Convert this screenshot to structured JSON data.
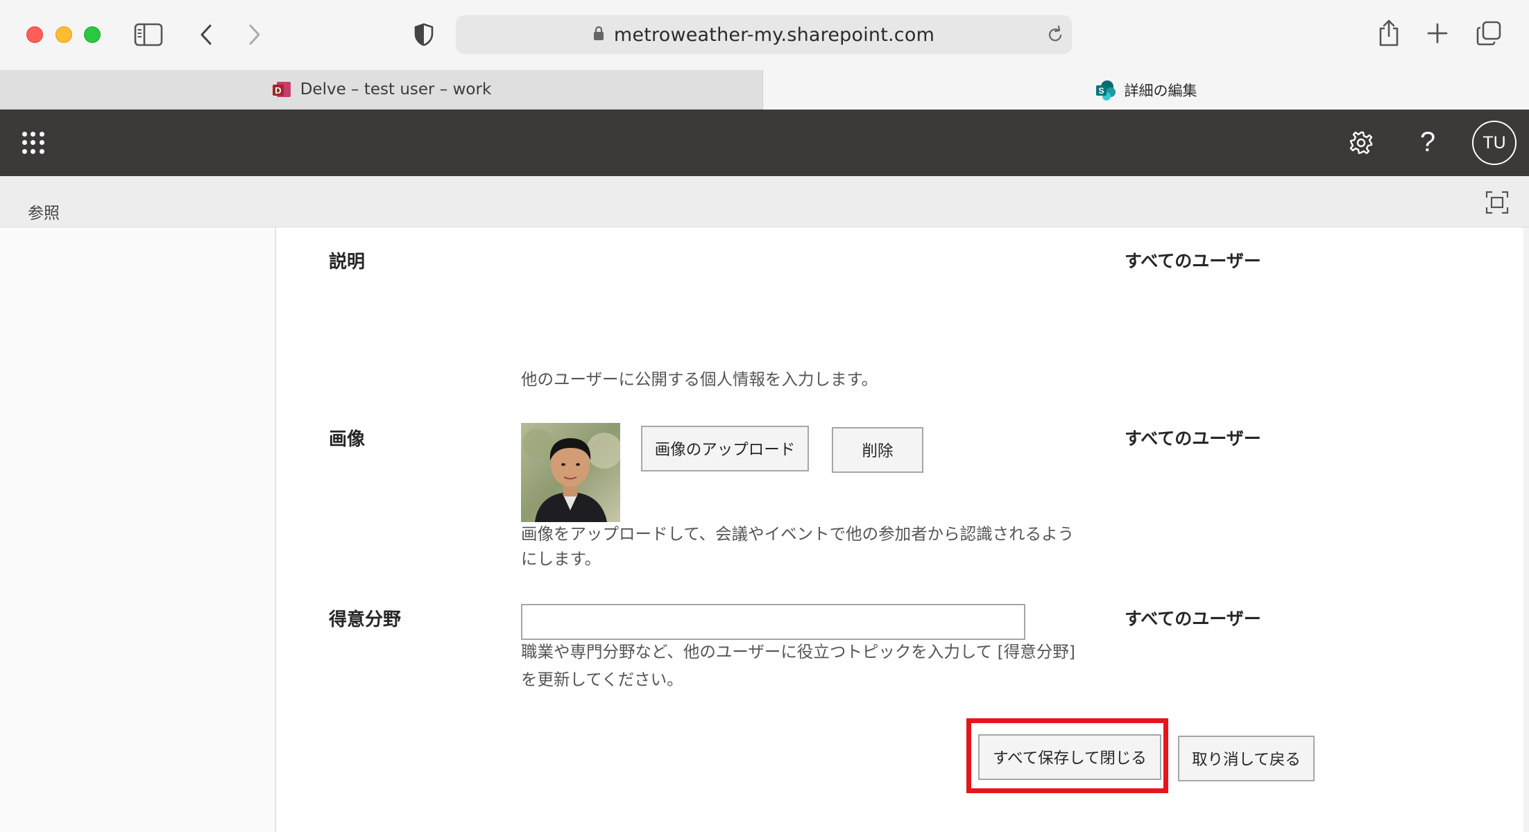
{
  "browser": {
    "url": "metroweather-my.sharepoint.com",
    "tabs": [
      {
        "label": "Delve – test user – work",
        "icon": "delve-favicon-icon",
        "active": false
      },
      {
        "label": "詳細の編集",
        "icon": "sharepoint-favicon-icon",
        "active": true
      }
    ]
  },
  "suite_bar": {
    "avatar_initials": "TU",
    "help_label": "?"
  },
  "ribbon": {
    "label": "参照"
  },
  "form": {
    "description": {
      "label": "説明",
      "scope": "すべてのユーザー",
      "hint": "他のユーザーに公開する個人情報を入力します。"
    },
    "picture": {
      "label": "画像",
      "scope": "すべてのユーザー",
      "upload_button": "画像のアップロード",
      "delete_button": "削除",
      "hint_line1": "画像をアップロードして、会議やイベントで他の参加者から認識されるよう",
      "hint_line2": "にします。"
    },
    "skills": {
      "label": "得意分野",
      "scope": "すべてのユーザー",
      "value": "",
      "hint_line1": "職業や専門分野など、他のユーザーに役立つトピックを入力して [得意分野]",
      "hint_line2": "を更新してください。"
    },
    "save_all_button": "すべて保存して閉じる",
    "cancel_button": "取り消して戻る"
  },
  "colors": {
    "suite_bar": "#3b3a39",
    "highlight": "#e8141c"
  }
}
